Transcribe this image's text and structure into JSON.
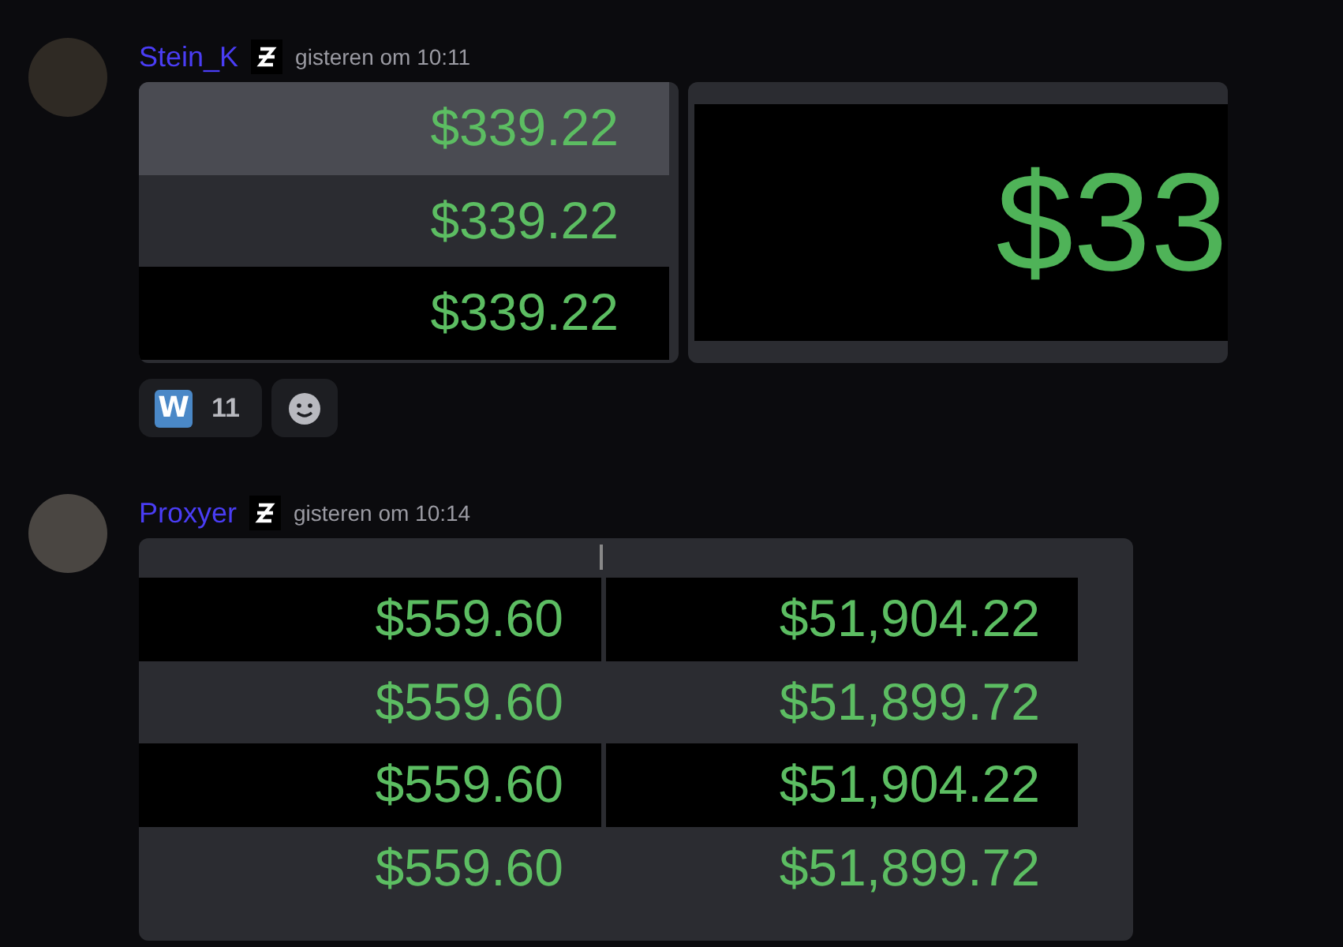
{
  "messages": [
    {
      "author": "Stein_K",
      "timestamp": "gisteren om 10:11",
      "attachments": [
        {
          "kind": "table",
          "rows": [
            {
              "kind": "highlight",
              "cells": [
                "$339.22"
              ]
            },
            {
              "kind": "stripe",
              "cells": [
                "$339.22"
              ]
            },
            {
              "kind": "plain",
              "cells": [
                "$339.22"
              ]
            }
          ]
        },
        {
          "kind": "zoom",
          "text": "$33"
        }
      ],
      "reactions": [
        {
          "kind": "emoji",
          "emoji": "W",
          "count": "11"
        },
        {
          "kind": "add"
        }
      ]
    },
    {
      "author": "Proxyer",
      "timestamp": "gisteren om 10:14",
      "attachments": [
        {
          "kind": "table",
          "rows": [
            {
              "kind": "plain",
              "cells": [
                "$559.60",
                "$51,904.22"
              ]
            },
            {
              "kind": "stripe",
              "cells": [
                "$559.60",
                "$51,899.72"
              ]
            },
            {
              "kind": "plain",
              "cells": [
                "$559.60",
                "$51,904.22"
              ]
            },
            {
              "kind": "stripe",
              "cells": [
                "$559.60",
                "$51,899.72"
              ]
            }
          ]
        }
      ]
    }
  ]
}
